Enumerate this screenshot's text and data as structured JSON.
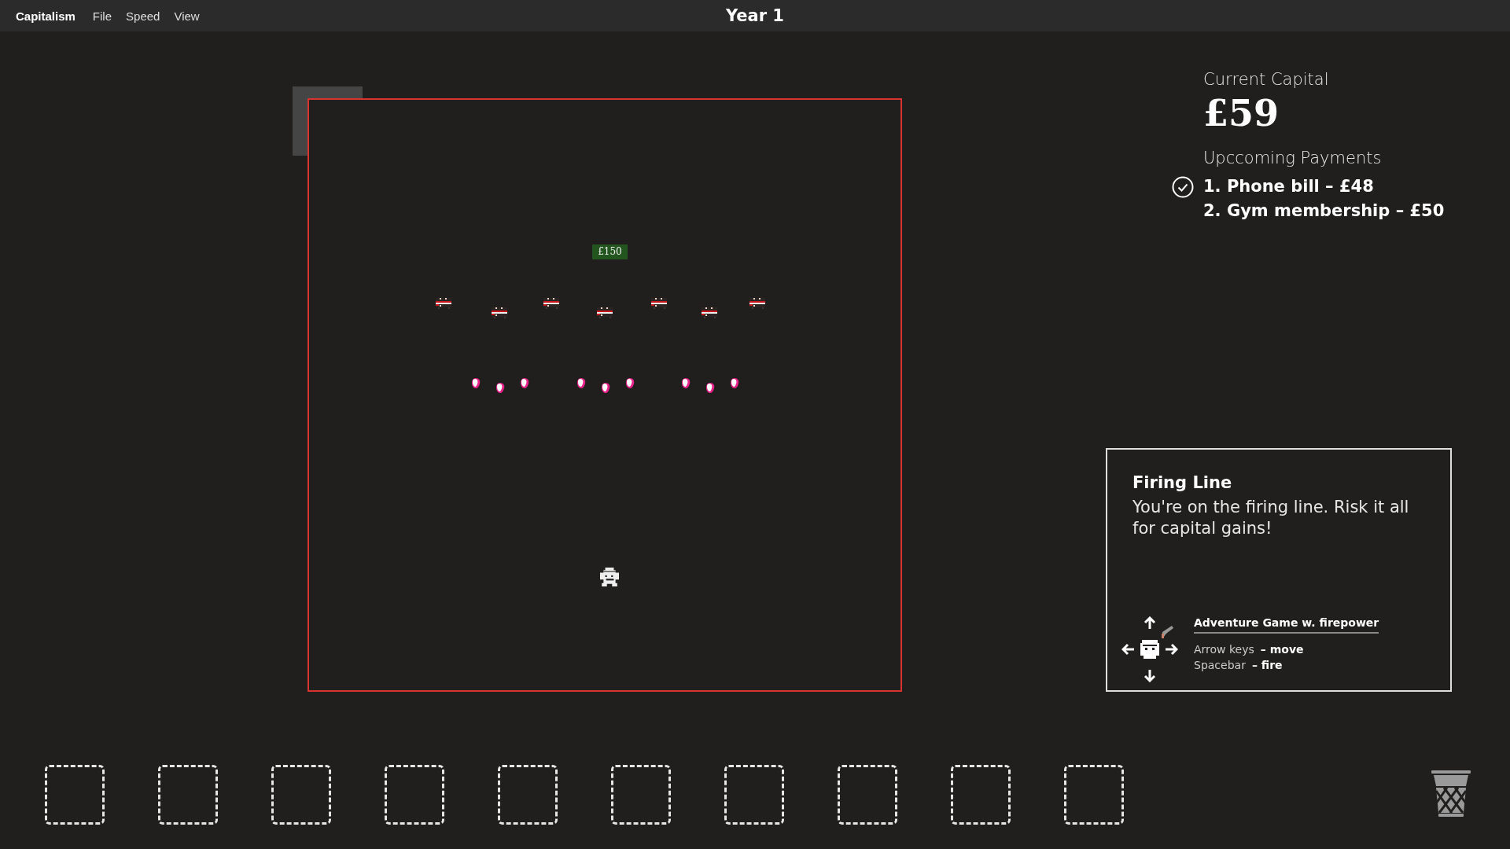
{
  "menu_bar": {
    "app_name": "Capitalism",
    "menus": [
      "File",
      "Speed",
      "View"
    ],
    "title": "Year 1"
  },
  "game": {
    "prize": "£150"
  },
  "capital": {
    "label": "Current Capital",
    "amount": "£59",
    "payments_label": "Upccoming Payments",
    "payments": [
      {
        "text": "1. Phone bill – £48",
        "paid": true
      },
      {
        "text": "2. Gym membership – £50",
        "paid": false
      }
    ]
  },
  "info_card": {
    "title": "Firing Line",
    "description": "You're on the firing line. Risk it all for capital gains!",
    "game_label": "Adventure Game w. firepower",
    "controls": [
      {
        "key": "Arrow keys",
        "action": "– move"
      },
      {
        "key": "Spacebar",
        "action": "– fire"
      }
    ]
  },
  "slots": [
    {
      "empty": true
    },
    {
      "empty": true
    },
    {
      "empty": true
    },
    {
      "empty": true
    },
    {
      "empty": true
    },
    {
      "empty": true
    },
    {
      "empty": true
    },
    {
      "empty": true
    },
    {
      "empty": true
    },
    {
      "empty": true
    }
  ]
}
